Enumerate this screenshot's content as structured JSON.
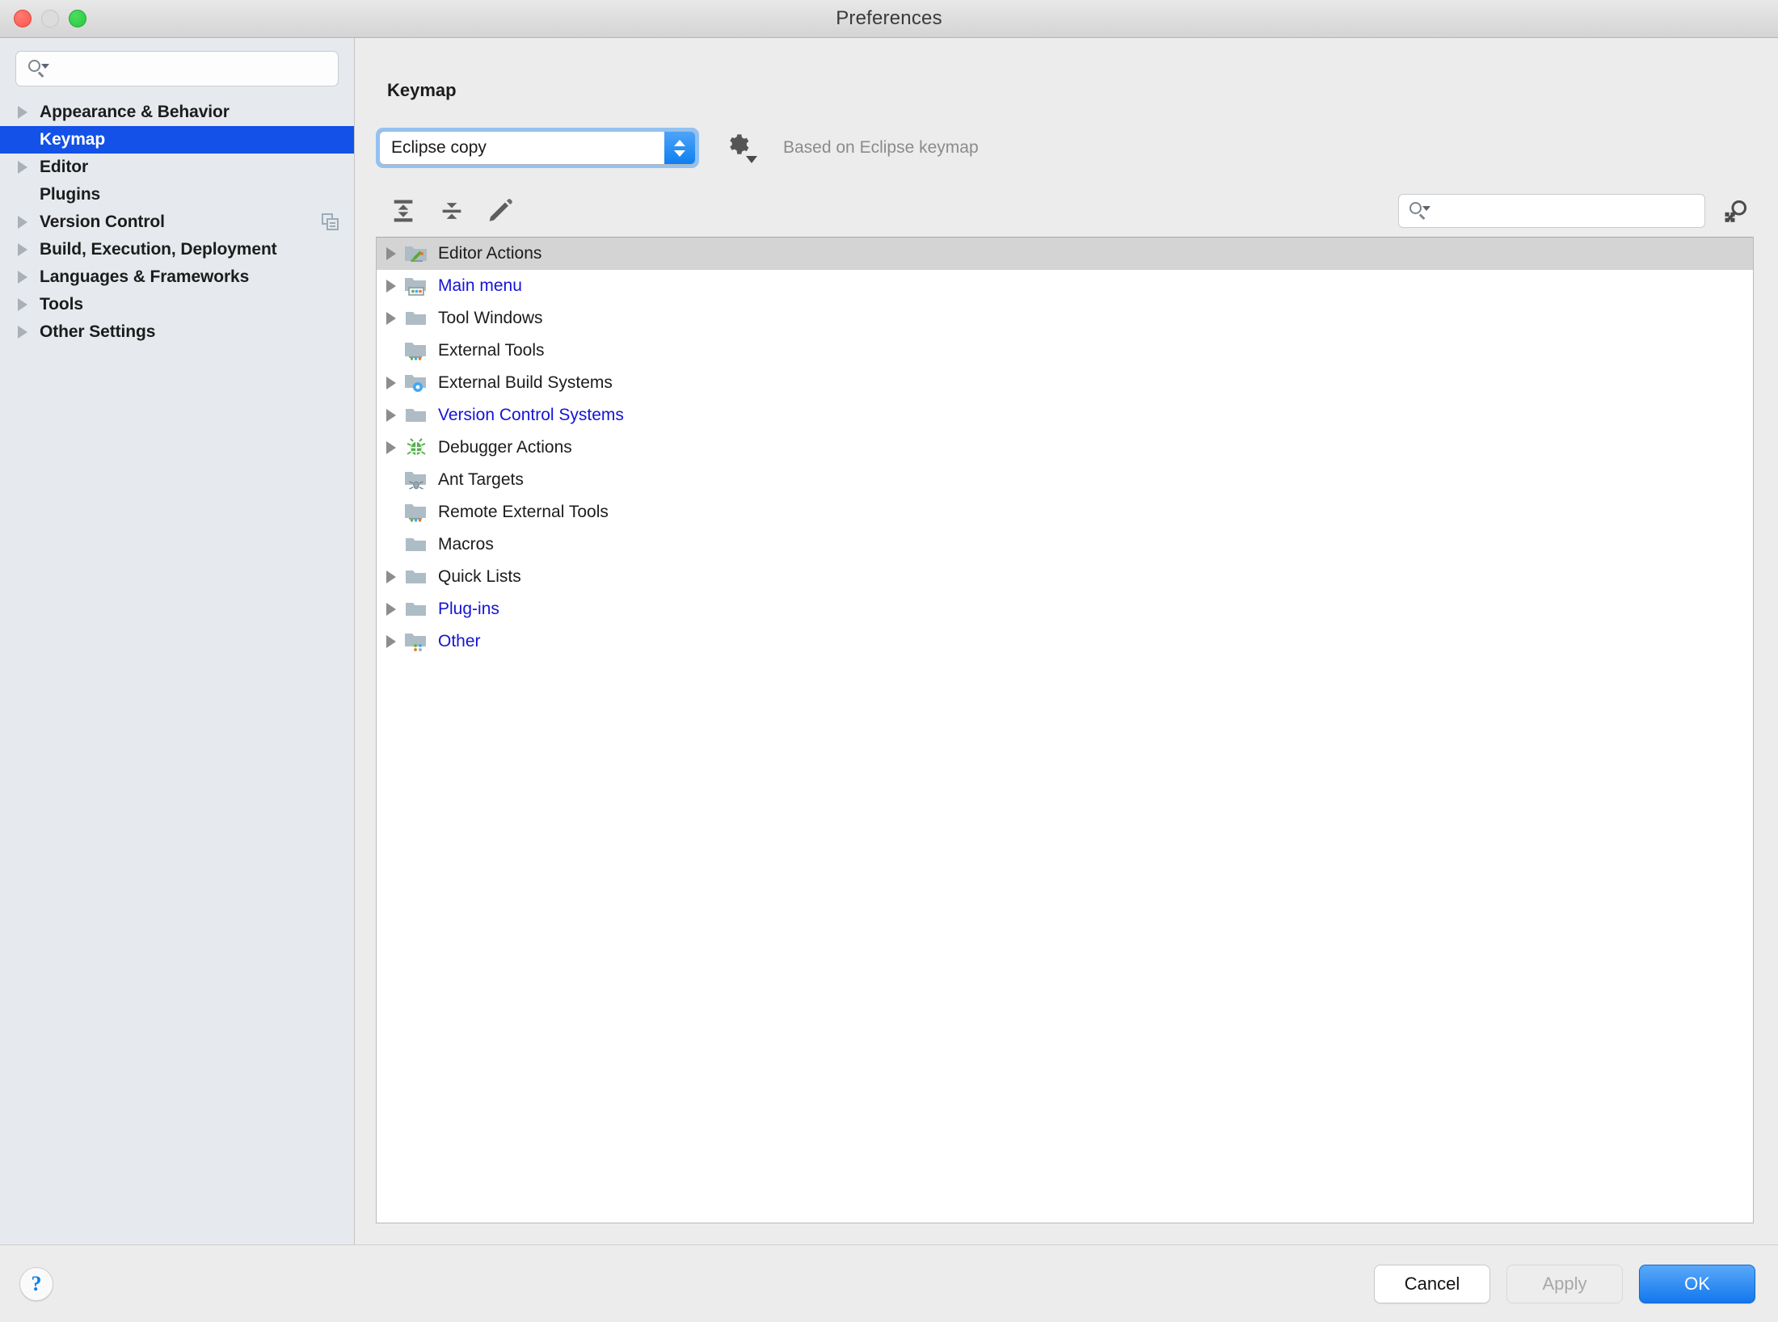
{
  "window": {
    "title": "Preferences",
    "controls": {
      "close": "close-button",
      "minimize": "minimize-button",
      "zoom": "zoom-button"
    }
  },
  "sidebar": {
    "search": {
      "value": "",
      "placeholder": ""
    },
    "items": [
      {
        "label": "Appearance & Behavior",
        "expandable": true,
        "selected": false,
        "badge": null
      },
      {
        "label": "Keymap",
        "expandable": false,
        "selected": true,
        "badge": null
      },
      {
        "label": "Editor",
        "expandable": true,
        "selected": false,
        "badge": null
      },
      {
        "label": "Plugins",
        "expandable": false,
        "selected": false,
        "badge": null
      },
      {
        "label": "Version Control",
        "expandable": true,
        "selected": false,
        "badge": "copy-icon"
      },
      {
        "label": "Build, Execution, Deployment",
        "expandable": true,
        "selected": false,
        "badge": null
      },
      {
        "label": "Languages & Frameworks",
        "expandable": true,
        "selected": false,
        "badge": null
      },
      {
        "label": "Tools",
        "expandable": true,
        "selected": false,
        "badge": null
      },
      {
        "label": "Other Settings",
        "expandable": true,
        "selected": false,
        "badge": null
      }
    ]
  },
  "main": {
    "page_title": "Keymap",
    "keymap_select": {
      "value": "Eclipse copy",
      "options": [
        "Eclipse copy"
      ]
    },
    "gear_label": "keymap-settings-gear",
    "based_on": "Based on Eclipse keymap",
    "toolbar": {
      "expand_all": "expand-all",
      "collapse_all": "collapse-all",
      "edit_shortcut": "edit-shortcut"
    },
    "tree_search": {
      "value": "",
      "placeholder": ""
    },
    "find_by_shortcut": "find-by-shortcut",
    "tree": [
      {
        "label": "Editor Actions",
        "expandable": true,
        "selected": true,
        "link": false,
        "icon": "folder-editor"
      },
      {
        "label": "Main menu",
        "expandable": true,
        "selected": false,
        "link": true,
        "icon": "folder-menu"
      },
      {
        "label": "Tool Windows",
        "expandable": true,
        "selected": false,
        "link": false,
        "icon": "folder-plain"
      },
      {
        "label": "External Tools",
        "expandable": false,
        "selected": false,
        "link": false,
        "icon": "folder-dots"
      },
      {
        "label": "External Build Systems",
        "expandable": true,
        "selected": false,
        "link": false,
        "icon": "folder-gear"
      },
      {
        "label": "Version Control Systems",
        "expandable": true,
        "selected": false,
        "link": true,
        "icon": "folder-plain"
      },
      {
        "label": "Debugger Actions",
        "expandable": true,
        "selected": false,
        "link": false,
        "icon": "bug"
      },
      {
        "label": "Ant Targets",
        "expandable": false,
        "selected": false,
        "link": false,
        "icon": "folder-ant"
      },
      {
        "label": "Remote External Tools",
        "expandable": false,
        "selected": false,
        "link": false,
        "icon": "folder-dots"
      },
      {
        "label": "Macros",
        "expandable": false,
        "selected": false,
        "link": false,
        "icon": "folder-plain"
      },
      {
        "label": "Quick Lists",
        "expandable": true,
        "selected": false,
        "link": false,
        "icon": "folder-plain"
      },
      {
        "label": "Plug-ins",
        "expandable": true,
        "selected": false,
        "link": true,
        "icon": "folder-plain"
      },
      {
        "label": "Other",
        "expandable": true,
        "selected": false,
        "link": true,
        "icon": "folder-quad"
      }
    ]
  },
  "footer": {
    "help": "?",
    "cancel": "Cancel",
    "apply": "Apply",
    "apply_disabled": true,
    "ok": "OK"
  },
  "colors": {
    "selection_blue": "#1351e8",
    "link_blue": "#1414d6",
    "ok_blue": "#1277ee",
    "tree_selection": "#d4d4d4",
    "sidebar_bg": "#e6eaee",
    "panel_bg": "#ececec",
    "folder": "#aebcc6"
  }
}
